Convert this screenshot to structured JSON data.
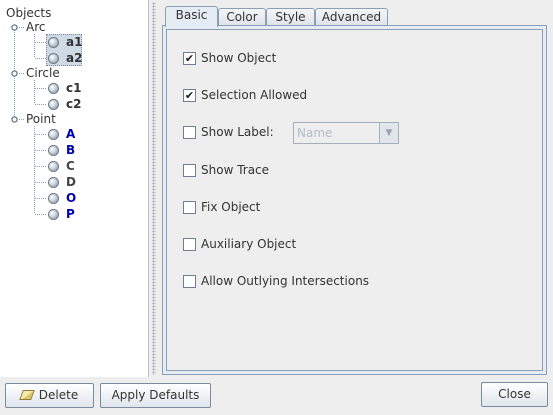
{
  "tree": {
    "root_label": "Objects",
    "groups": [
      {
        "label": "Arc",
        "items": [
          {
            "label": "a1",
            "color": "#000000"
          },
          {
            "label": "a2",
            "color": "#000000"
          }
        ]
      },
      {
        "label": "Circle",
        "items": [
          {
            "label": "c1",
            "color": "#000000"
          },
          {
            "label": "c2",
            "color": "#000000"
          }
        ]
      },
      {
        "label": "Point",
        "items": [
          {
            "label": "A",
            "color": "#0000aa"
          },
          {
            "label": "B",
            "color": "#0000aa"
          },
          {
            "label": "C",
            "color": "#444444"
          },
          {
            "label": "D",
            "color": "#444444"
          },
          {
            "label": "O",
            "color": "#0000aa"
          },
          {
            "label": "P",
            "color": "#0000aa"
          }
        ]
      }
    ]
  },
  "tabs": [
    {
      "label": "Basic",
      "active": true
    },
    {
      "label": "Color",
      "active": false
    },
    {
      "label": "Style",
      "active": false
    },
    {
      "label": "Advanced",
      "active": false
    }
  ],
  "basic": {
    "show_object": {
      "label": "Show Object",
      "checked": true
    },
    "selection_allowed": {
      "label": "Selection Allowed",
      "checked": true
    },
    "show_label": {
      "label": "Show Label:",
      "checked": false,
      "select_value": "Name"
    },
    "show_trace": {
      "label": "Show Trace",
      "checked": false
    },
    "fix_object": {
      "label": "Fix Object",
      "checked": false
    },
    "auxiliary_object": {
      "label": "Auxiliary Object",
      "checked": false
    },
    "allow_outlying": {
      "label": "Allow Outlying Intersections",
      "checked": false
    }
  },
  "buttons": {
    "delete": "Delete",
    "apply_defaults": "Apply Defaults",
    "close": "Close"
  }
}
